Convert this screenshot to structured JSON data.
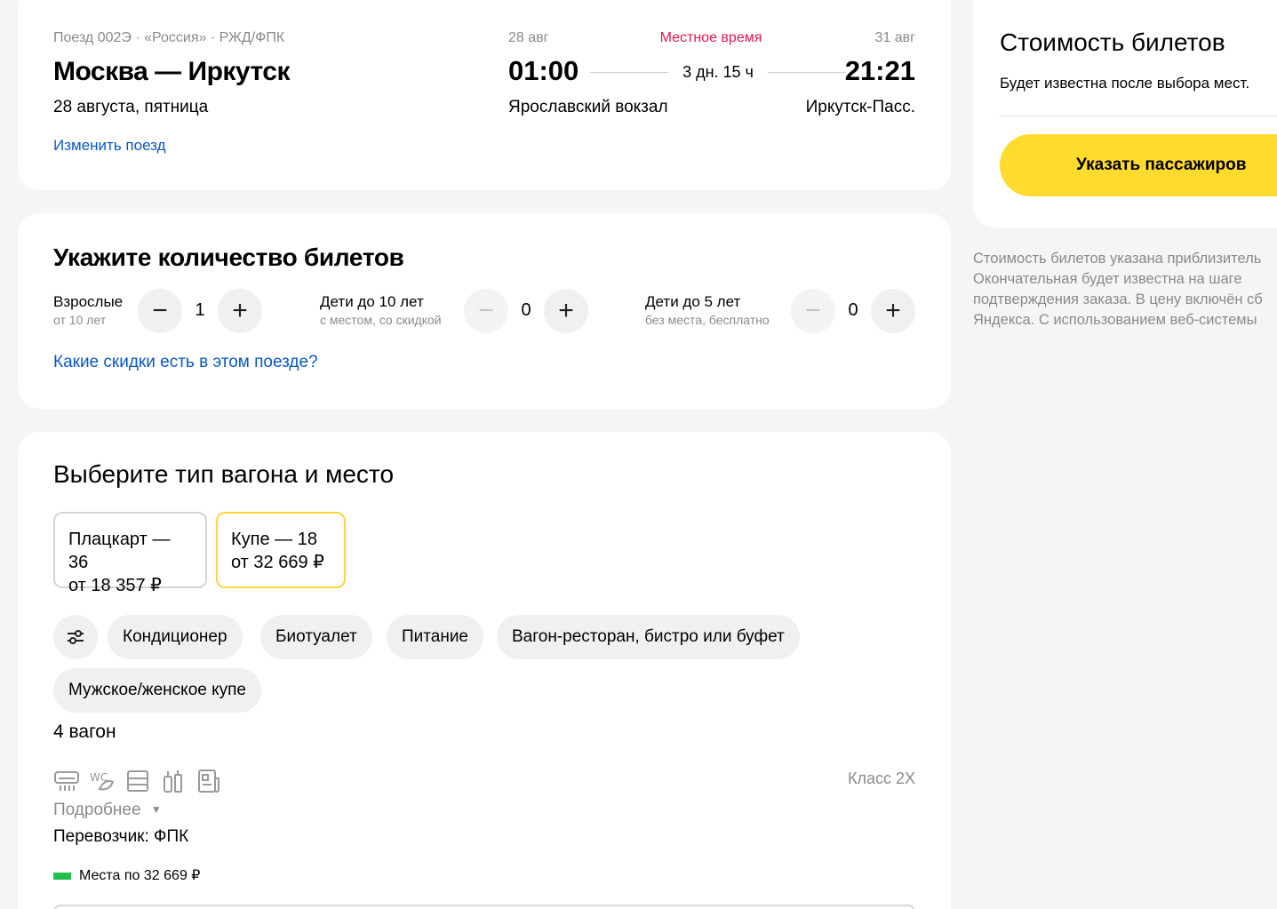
{
  "train": {
    "meta": "Поезд 002Э · «Россия» · РЖД/ФПК",
    "route": "Москва — Иркутск",
    "date": "28 августа, пятница",
    "change_link": "Изменить поезд",
    "departure_date": "28 авг",
    "local_time_label": "Местное время",
    "arrival_date": "31 авг",
    "departure_time": "01:00",
    "duration": "3 дн. 15 ч",
    "arrival_time": "21:21",
    "departure_station": "Ярославский вокзал",
    "arrival_station": "Иркутск-Пасс."
  },
  "tickets": {
    "title": "Укажите количество билетов",
    "groups": [
      {
        "label": "Взрослые",
        "sub": "от 10 лет",
        "value": "1"
      },
      {
        "label": "Дети до 10 лет",
        "sub": "с местом, со скидкой",
        "value": "0"
      },
      {
        "label": "Дети до 5 лет",
        "sub": "без места, бесплатно",
        "value": "0"
      }
    ],
    "minus": "−",
    "plus": "+",
    "discount_link": "Какие скидки есть в этом поезде?"
  },
  "wagon": {
    "title": "Выберите тип вагона и место",
    "classes": [
      {
        "name": "Плацкарт — 36",
        "price": "от 18 357 ₽"
      },
      {
        "name": "Купе — 18",
        "price": "от 32 669 ₽"
      }
    ],
    "filters": [
      "Кондиционер",
      "Биотуалет",
      "Питание",
      "Вагон-ресторан, бистро или буфет",
      "Мужское/женское купе"
    ],
    "wagon_number": "4 вагон",
    "class_label": "Класс 2Х",
    "details": "Подробнее",
    "carrier": "Перевозчик: ФПК",
    "legend": "Места по 32 669 ₽",
    "legend_color": "#21c04d"
  },
  "price": {
    "title": "Стоимость билетов",
    "subtitle": "Будет известна после выбора мест.",
    "button": "Указать пассажиров",
    "note_lines": [
      "Стоимость билетов указана приблизитель",
      "Окончательная будет известна на шаге",
      "подтверждения заказа. В цену включён сб",
      "Яндекса. С использованием веб-системы"
    ]
  },
  "colors": {
    "accent": "#ffdb2d",
    "link": "#0a57c7",
    "local_time": "#e2184c"
  }
}
